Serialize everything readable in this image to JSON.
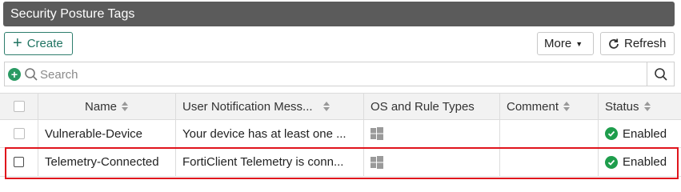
{
  "header": {
    "title": "Security Posture Tags"
  },
  "toolbar": {
    "create_label": "Create",
    "more_label": "More",
    "refresh_label": "Refresh"
  },
  "search": {
    "placeholder": "Search",
    "value": ""
  },
  "table": {
    "columns": [
      "Name",
      "User Notification Mess...",
      "OS and Rule Types",
      "Comment",
      "Status"
    ],
    "rows": [
      {
        "name": "Vulnerable-Device",
        "notification": "Your device has at least one ...",
        "os": "windows-icon",
        "comment": "",
        "status": "Enabled"
      },
      {
        "name": "Telemetry-Connected",
        "notification": "FortiClient Telemetry is conn...",
        "os": "windows-icon",
        "comment": "",
        "status": "Enabled"
      }
    ]
  },
  "colors": {
    "accent": "#1f7361",
    "enabled": "#1e9d4c",
    "highlight": "#e0141c",
    "header_bg": "#5b5b5b"
  }
}
